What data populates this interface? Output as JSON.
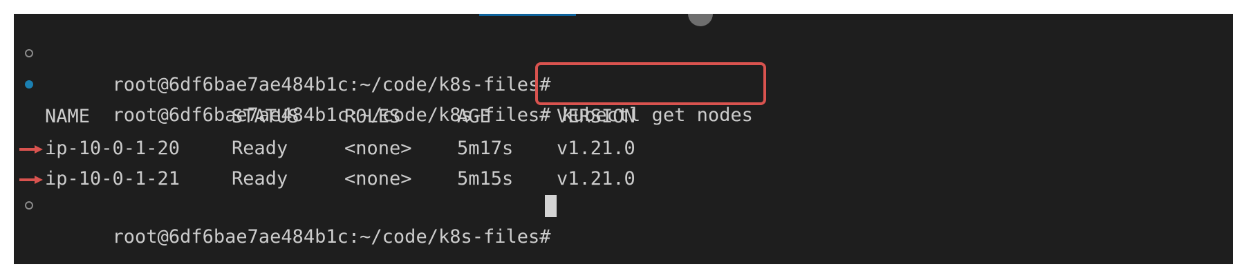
{
  "terminal": {
    "prompt": "root@6df6bae7ae484b1c:~/code/k8s-files#",
    "command": "kubectl get nodes",
    "table": {
      "headers": [
        "NAME",
        "STATUS",
        "ROLES",
        "AGE",
        "VERSION"
      ],
      "rows": [
        [
          "ip-10-0-1-20",
          "Ready",
          "<none>",
          "5m17s",
          "v1.21.0"
        ],
        [
          "ip-10-0-1-21",
          "Ready",
          "<none>",
          "5m15s",
          "v1.21.0"
        ]
      ]
    }
  },
  "annotations": {
    "highlight_color": "#d9534f",
    "row_arrow_icon": "right-arrow-icon"
  },
  "colors": {
    "background": "#1e1e1e",
    "text": "#cccccc",
    "success_decoration": "#1b80b2",
    "idle_decoration": "#8b8b8b"
  }
}
